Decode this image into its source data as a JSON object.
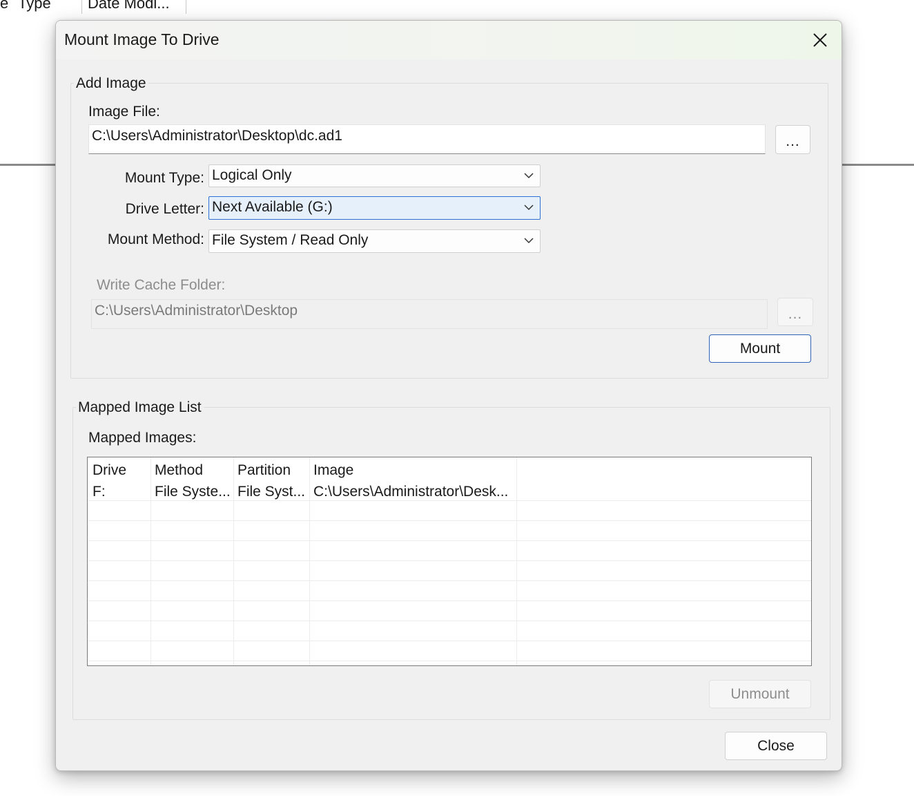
{
  "background_window": {
    "col_fragment": "e",
    "col_type": "Type",
    "col_date_modified": "Date Modi..."
  },
  "dialog": {
    "title": "Mount Image To Drive",
    "close_icon": "close-x-icon",
    "add_image": {
      "group_label": "Add Image",
      "image_file_label": "Image File:",
      "image_file_value": "C:\\Users\\Administrator\\Desktop\\dc.ad1",
      "browse_label": "...",
      "mount_type_label": "Mount Type:",
      "mount_type_value": "Logical Only",
      "drive_letter_label": "Drive Letter:",
      "drive_letter_value": "Next Available (G:)",
      "mount_method_label": "Mount Method:",
      "mount_method_value": "File System / Read Only",
      "write_cache_label": "Write Cache Folder:",
      "write_cache_value": "C:\\Users\\Administrator\\Desktop",
      "write_cache_browse_label": "...",
      "mount_button": "Mount"
    },
    "mapped_list": {
      "group_label": "Mapped Image List",
      "mapped_images_label": "Mapped Images:",
      "columns": [
        "Drive",
        "Method",
        "Partition",
        "Image"
      ],
      "rows": [
        [
          "F:",
          "File Syste...",
          "File Syst...",
          "C:\\Users\\Administrator\\Desk..."
        ]
      ],
      "unmount_button": "Unmount"
    },
    "close_button": "Close"
  },
  "colors": {
    "accent": "#2e63b8",
    "focus_fill": "#e6f0fb",
    "dialog_bg": "#f0f0f0"
  }
}
